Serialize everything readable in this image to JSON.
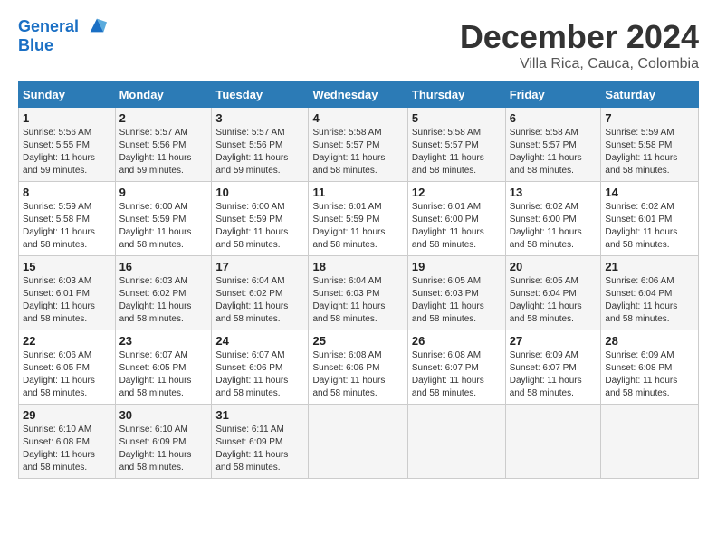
{
  "logo": {
    "line1": "General",
    "line2": "Blue"
  },
  "title": "December 2024",
  "location": "Villa Rica, Cauca, Colombia",
  "weekdays": [
    "Sunday",
    "Monday",
    "Tuesday",
    "Wednesday",
    "Thursday",
    "Friday",
    "Saturday"
  ],
  "weeks": [
    [
      {
        "day": "1",
        "info": "Sunrise: 5:56 AM\nSunset: 5:55 PM\nDaylight: 11 hours\nand 59 minutes."
      },
      {
        "day": "2",
        "info": "Sunrise: 5:57 AM\nSunset: 5:56 PM\nDaylight: 11 hours\nand 59 minutes."
      },
      {
        "day": "3",
        "info": "Sunrise: 5:57 AM\nSunset: 5:56 PM\nDaylight: 11 hours\nand 59 minutes."
      },
      {
        "day": "4",
        "info": "Sunrise: 5:58 AM\nSunset: 5:57 PM\nDaylight: 11 hours\nand 58 minutes."
      },
      {
        "day": "5",
        "info": "Sunrise: 5:58 AM\nSunset: 5:57 PM\nDaylight: 11 hours\nand 58 minutes."
      },
      {
        "day": "6",
        "info": "Sunrise: 5:58 AM\nSunset: 5:57 PM\nDaylight: 11 hours\nand 58 minutes."
      },
      {
        "day": "7",
        "info": "Sunrise: 5:59 AM\nSunset: 5:58 PM\nDaylight: 11 hours\nand 58 minutes."
      }
    ],
    [
      {
        "day": "8",
        "info": "Sunrise: 5:59 AM\nSunset: 5:58 PM\nDaylight: 11 hours\nand 58 minutes."
      },
      {
        "day": "9",
        "info": "Sunrise: 6:00 AM\nSunset: 5:59 PM\nDaylight: 11 hours\nand 58 minutes."
      },
      {
        "day": "10",
        "info": "Sunrise: 6:00 AM\nSunset: 5:59 PM\nDaylight: 11 hours\nand 58 minutes."
      },
      {
        "day": "11",
        "info": "Sunrise: 6:01 AM\nSunset: 5:59 PM\nDaylight: 11 hours\nand 58 minutes."
      },
      {
        "day": "12",
        "info": "Sunrise: 6:01 AM\nSunset: 6:00 PM\nDaylight: 11 hours\nand 58 minutes."
      },
      {
        "day": "13",
        "info": "Sunrise: 6:02 AM\nSunset: 6:00 PM\nDaylight: 11 hours\nand 58 minutes."
      },
      {
        "day": "14",
        "info": "Sunrise: 6:02 AM\nSunset: 6:01 PM\nDaylight: 11 hours\nand 58 minutes."
      }
    ],
    [
      {
        "day": "15",
        "info": "Sunrise: 6:03 AM\nSunset: 6:01 PM\nDaylight: 11 hours\nand 58 minutes."
      },
      {
        "day": "16",
        "info": "Sunrise: 6:03 AM\nSunset: 6:02 PM\nDaylight: 11 hours\nand 58 minutes."
      },
      {
        "day": "17",
        "info": "Sunrise: 6:04 AM\nSunset: 6:02 PM\nDaylight: 11 hours\nand 58 minutes."
      },
      {
        "day": "18",
        "info": "Sunrise: 6:04 AM\nSunset: 6:03 PM\nDaylight: 11 hours\nand 58 minutes."
      },
      {
        "day": "19",
        "info": "Sunrise: 6:05 AM\nSunset: 6:03 PM\nDaylight: 11 hours\nand 58 minutes."
      },
      {
        "day": "20",
        "info": "Sunrise: 6:05 AM\nSunset: 6:04 PM\nDaylight: 11 hours\nand 58 minutes."
      },
      {
        "day": "21",
        "info": "Sunrise: 6:06 AM\nSunset: 6:04 PM\nDaylight: 11 hours\nand 58 minutes."
      }
    ],
    [
      {
        "day": "22",
        "info": "Sunrise: 6:06 AM\nSunset: 6:05 PM\nDaylight: 11 hours\nand 58 minutes."
      },
      {
        "day": "23",
        "info": "Sunrise: 6:07 AM\nSunset: 6:05 PM\nDaylight: 11 hours\nand 58 minutes."
      },
      {
        "day": "24",
        "info": "Sunrise: 6:07 AM\nSunset: 6:06 PM\nDaylight: 11 hours\nand 58 minutes."
      },
      {
        "day": "25",
        "info": "Sunrise: 6:08 AM\nSunset: 6:06 PM\nDaylight: 11 hours\nand 58 minutes."
      },
      {
        "day": "26",
        "info": "Sunrise: 6:08 AM\nSunset: 6:07 PM\nDaylight: 11 hours\nand 58 minutes."
      },
      {
        "day": "27",
        "info": "Sunrise: 6:09 AM\nSunset: 6:07 PM\nDaylight: 11 hours\nand 58 minutes."
      },
      {
        "day": "28",
        "info": "Sunrise: 6:09 AM\nSunset: 6:08 PM\nDaylight: 11 hours\nand 58 minutes."
      }
    ],
    [
      {
        "day": "29",
        "info": "Sunrise: 6:10 AM\nSunset: 6:08 PM\nDaylight: 11 hours\nand 58 minutes."
      },
      {
        "day": "30",
        "info": "Sunrise: 6:10 AM\nSunset: 6:09 PM\nDaylight: 11 hours\nand 58 minutes."
      },
      {
        "day": "31",
        "info": "Sunrise: 6:11 AM\nSunset: 6:09 PM\nDaylight: 11 hours\nand 58 minutes."
      },
      {
        "day": "",
        "info": ""
      },
      {
        "day": "",
        "info": ""
      },
      {
        "day": "",
        "info": ""
      },
      {
        "day": "",
        "info": ""
      }
    ]
  ]
}
